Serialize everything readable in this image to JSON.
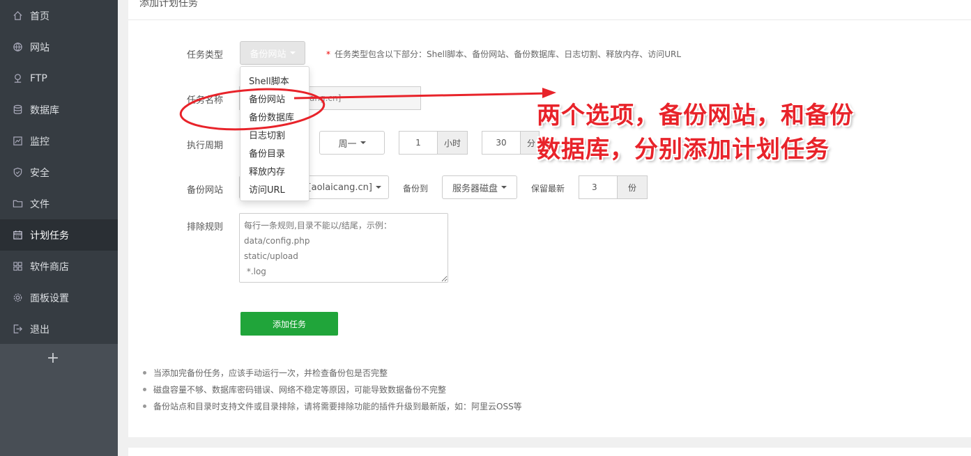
{
  "sidebar": {
    "items": [
      {
        "label": "首页",
        "icon": "home-icon"
      },
      {
        "label": "网站",
        "icon": "globe-icon"
      },
      {
        "label": "FTP",
        "icon": "ftp-icon"
      },
      {
        "label": "数据库",
        "icon": "database-icon"
      },
      {
        "label": "监控",
        "icon": "monitor-icon"
      },
      {
        "label": "安全",
        "icon": "shield-icon"
      },
      {
        "label": "文件",
        "icon": "folder-icon"
      },
      {
        "label": "计划任务",
        "icon": "calendar-icon"
      },
      {
        "label": "软件商店",
        "icon": "grid-icon"
      },
      {
        "label": "面板设置",
        "icon": "gear-icon"
      },
      {
        "label": "退出",
        "icon": "logout-icon"
      }
    ],
    "active": "计划任务",
    "add_label": "+"
  },
  "panel": {
    "title": "添加计划任务"
  },
  "form": {
    "task_type_label": "任务类型",
    "task_type_value": "备份网站",
    "task_type_hint": "任务类型包含以下部分：Shell脚本、备份网站、备份数据库、日志切割、释放内存、访问URL",
    "task_type_options": [
      "Shell脚本",
      "备份网站",
      "备份数据库",
      "日志切割",
      "备份目录",
      "释放内存",
      "访问URL"
    ],
    "task_name_label": "任务名称",
    "task_name_value_partial": "ang.cn]",
    "period_label": "执行周期",
    "period_day": "周一",
    "period_hour": "1",
    "period_hour_unit": "小时",
    "period_minute": "30",
    "period_minute_unit_partial": "分",
    "backup_site_label": "备份网站",
    "backup_site_value_partial": "[aolaicang.cn]",
    "backup_to_label": "备份到",
    "backup_to_value": "服务器磁盘",
    "retain_label": "保留最新",
    "retain_value": "3",
    "retain_unit": "份",
    "exclude_label": "排除规则",
    "exclude_placeholder": "每行一条规则,目录不能以/结尾，示例：\ndata/config.php\nstatic/upload\n *.log",
    "submit_label": "添加任务"
  },
  "notes": [
    "当添加完备份任务，应该手动运行一次，并检查备份包是否完整",
    "磁盘容量不够、数据库密码错误、网络不稳定等原因，可能导致数据备份不完整",
    "备份站点和目录时支持文件或目录排除，请将需要排除功能的插件升级到最新版，如：阿里云OSS等"
  ],
  "annotation": {
    "line1": "两个选项，备份网站，和备份",
    "line2": "数据库，分别添加计划任务",
    "color": "#e8232a"
  },
  "colors": {
    "sidebar_bg": "#363c42",
    "accent_green": "#20a53a"
  }
}
